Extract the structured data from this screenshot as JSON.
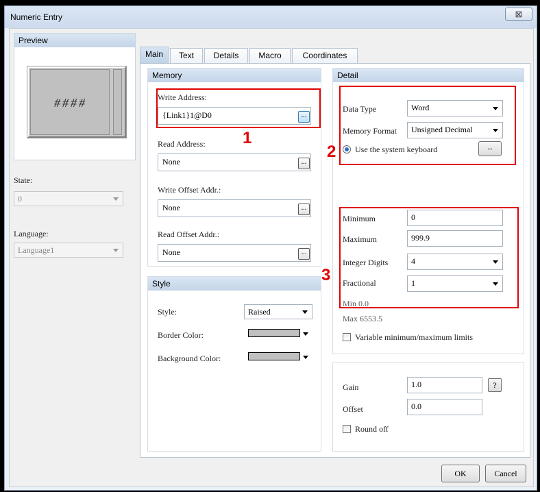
{
  "window": {
    "title": "Numeric Entry",
    "close_glyph": "⊠"
  },
  "preview": {
    "header": "Preview",
    "display": "####"
  },
  "left": {
    "state_label": "State:",
    "state_value": "0",
    "language_label": "Language:",
    "language_value": "Language1"
  },
  "tabs": [
    "Main",
    "Text",
    "Details",
    "Macro",
    "Coordinates"
  ],
  "memory": {
    "header": "Memory",
    "write_address_label": "Write Address:",
    "write_address_value": "{Link1}1@D0",
    "read_address_label": "Read Address:",
    "read_address_value": "None",
    "write_offset_label": "Write Offset Addr.:",
    "write_offset_value": "None",
    "read_offset_label": "Read Offset Addr.:",
    "read_offset_value": "None",
    "browse_label": "..."
  },
  "style": {
    "header": "Style",
    "style_label": "Style:",
    "style_value": "Raised",
    "border_color_label": "Border Color:",
    "background_color_label": "Background Color:"
  },
  "detail": {
    "header": "Detail",
    "data_type_label": "Data Type",
    "data_type_value": "Word",
    "memory_format_label": "Memory Format",
    "memory_format_value": "Unsigned Decimal",
    "system_keyboard_label": "Use the system keyboard",
    "keyboard_btn_label": "...",
    "minimum_label": "Minimum",
    "minimum_value": "0",
    "maximum_label": "Maximum",
    "maximum_value": "999.9",
    "integer_digits_label": "Integer Digits",
    "integer_digits_value": "4",
    "fractional_label": "Fractional",
    "fractional_value": "1",
    "min_info": "Min 0.0",
    "max_info": "Max 6553.5",
    "variable_limits_label": "Variable minimum/maximum limits"
  },
  "gain": {
    "gain_label": "Gain",
    "gain_value": "1.0",
    "help_label": "?",
    "offset_label": "Offset",
    "offset_value": "0.0",
    "round_off_label": "Round off"
  },
  "annotations": {
    "n1": "1",
    "n2": "2",
    "n3": "3"
  },
  "buttons": {
    "ok": "OK",
    "cancel": "Cancel"
  },
  "colors": {
    "annotation_red": "#e00000",
    "header_blue": "#c4d5e8"
  }
}
